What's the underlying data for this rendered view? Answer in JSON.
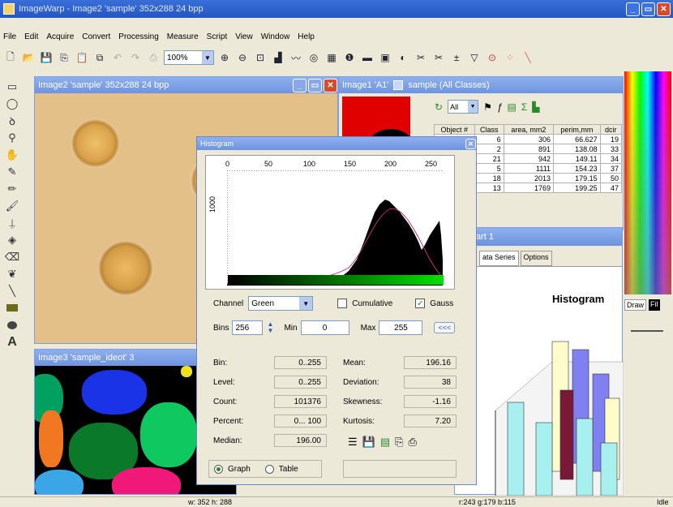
{
  "app": {
    "title": "ImageWarp - Image2 'sample' 352x288 24 bpp"
  },
  "menu": [
    "File",
    "Edit",
    "Acquire",
    "Convert",
    "Processing",
    "Measure",
    "Script",
    "View",
    "Window",
    "Help"
  ],
  "toolbar": {
    "zoom": "100%"
  },
  "image2": {
    "title": "Image2 'sample' 352x288 24 bpp"
  },
  "image1": {
    "title": "Image1 'A1'",
    "tab_label": "sample (All Classes)",
    "filter_value": "All"
  },
  "image3": {
    "title": "Image3 'sample_ideot' 3"
  },
  "objects_table": {
    "headers": [
      "Object #",
      "Class",
      "area, mm2",
      "perim,mm",
      "dcir"
    ],
    "rows": [
      [
        "",
        "6",
        "306",
        "66.627",
        "19"
      ],
      [
        "",
        "2",
        "891",
        "138.08",
        "33"
      ],
      [
        "",
        "21",
        "942",
        "149.11",
        "34"
      ],
      [
        "",
        "5",
        "1111",
        "154.23",
        "37"
      ],
      [
        "",
        "18",
        "2013",
        "179.15",
        "50"
      ],
      [
        "",
        "13",
        "1769",
        "199.25",
        "47"
      ]
    ]
  },
  "chart_window": {
    "title_fragment": "art 1",
    "tabs": [
      "ata Series",
      "Options"
    ],
    "chart_title": "Histogram"
  },
  "right_panel": {
    "draw_label": "Draw",
    "fill_label": "Fil"
  },
  "histogram": {
    "title": "Histogram",
    "x_ticks": [
      "0",
      "50",
      "100",
      "150",
      "200",
      "250"
    ],
    "y_tick": "1000",
    "channel_label": "Channel",
    "channel_value": "Green",
    "cumulative_label": "Cumulative",
    "cumulative_checked": false,
    "gauss_label": "Gauss",
    "gauss_checked": true,
    "bins_label": "Bins",
    "bins_value": "256",
    "min_label": "Min",
    "min_value": "0",
    "max_label": "Max",
    "max_value": "255",
    "reset_label": "<<<",
    "stats_left": [
      {
        "label": "Bin:",
        "value": "0..255"
      },
      {
        "label": "Level:",
        "value": "0..255"
      },
      {
        "label": "Count:",
        "value": "101376"
      },
      {
        "label": "Percent:",
        "value": "0... 100"
      },
      {
        "label": "Median:",
        "value": "196.00"
      }
    ],
    "stats_right": [
      {
        "label": "Mean:",
        "value": "196.16"
      },
      {
        "label": "Deviation:",
        "value": "38"
      },
      {
        "label": "Skewness:",
        "value": "-1.16"
      },
      {
        "label": "Kurtosis:",
        "value": "7.20"
      }
    ],
    "view_graph": "Graph",
    "view_table": "Table",
    "view_selected": "Graph"
  },
  "statusbar": {
    "size": "w: 352 h: 288",
    "pixel": "r:243 g:179 b:115",
    "state": "Idle"
  },
  "colors": {
    "title_blue": "#2456c4",
    "child_title": "#7a9ee6",
    "histogram_fill": "#000000",
    "gauss_curve": "#c03070",
    "green_gradient_end": "#00e000"
  }
}
